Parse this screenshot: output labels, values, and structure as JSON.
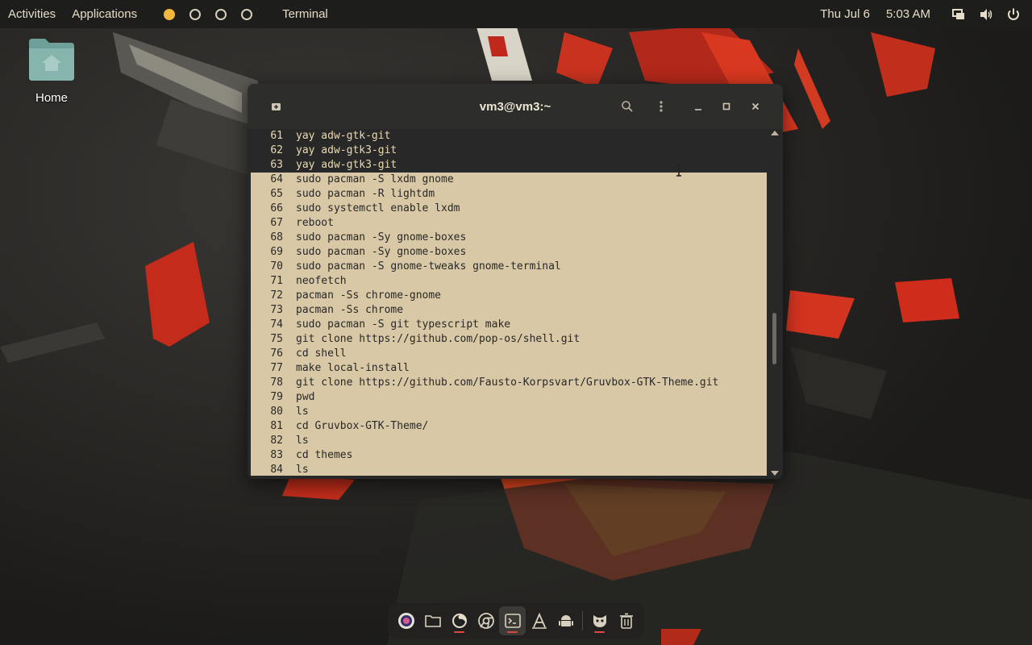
{
  "topbar": {
    "activities": "Activities",
    "applications": "Applications",
    "app_name": "Terminal",
    "date": "Thu Jul 6",
    "time": "5:03 AM",
    "workspaces": 4,
    "active_workspace": 1
  },
  "desktop": {
    "home_label": "Home"
  },
  "terminal": {
    "title": "vm3@vm3:~",
    "lines": [
      {
        "num": "61",
        "cmd": "yay adw-gtk-git",
        "selected": false
      },
      {
        "num": "62",
        "cmd": "yay adw-gtk3-git",
        "selected": false
      },
      {
        "num": "63",
        "cmd": "yay adw-gtk3-git",
        "selected": false
      },
      {
        "num": "64",
        "cmd": "sudo pacman -S lxdm gnome",
        "selected": true
      },
      {
        "num": "65",
        "cmd": "sudo pacman -R lightdm",
        "selected": true
      },
      {
        "num": "66",
        "cmd": "sudo systemctl enable lxdm",
        "selected": true
      },
      {
        "num": "67",
        "cmd": "reboot",
        "selected": true
      },
      {
        "num": "68",
        "cmd": "sudo pacman -Sy gnome-boxes",
        "selected": true
      },
      {
        "num": "69",
        "cmd": "sudo pacman -Sy gnome-boxes",
        "selected": true
      },
      {
        "num": "70",
        "cmd": "sudo pacman -S gnome-tweaks gnome-terminal",
        "selected": true
      },
      {
        "num": "71",
        "cmd": "neofetch",
        "selected": true
      },
      {
        "num": "72",
        "cmd": "pacman -Ss chrome-gnome",
        "selected": true
      },
      {
        "num": "73",
        "cmd": "pacman -Ss chrome",
        "selected": true
      },
      {
        "num": "74",
        "cmd": "sudo pacman -S git typescript make",
        "selected": true
      },
      {
        "num": "75",
        "cmd": "git clone https://github.com/pop-os/shell.git",
        "selected": true
      },
      {
        "num": "76",
        "cmd": "cd shell",
        "selected": true
      },
      {
        "num": "77",
        "cmd": "make local-install",
        "selected": true
      },
      {
        "num": "78",
        "cmd": "git clone https://github.com/Fausto-Korpsvart/Gruvbox-GTK-Theme.git",
        "selected": true
      },
      {
        "num": "79",
        "cmd": "pwd",
        "selected": true
      },
      {
        "num": "80",
        "cmd": "ls",
        "selected": true
      },
      {
        "num": "81",
        "cmd": "cd Gruvbox-GTK-Theme/",
        "selected": true
      },
      {
        "num": "82",
        "cmd": "ls",
        "selected": true
      },
      {
        "num": "83",
        "cmd": "cd themes",
        "selected": true
      },
      {
        "num": "84",
        "cmd": "ls",
        "selected": true
      }
    ]
  },
  "dock": {
    "items": [
      {
        "icon": "browser-icon",
        "running": false
      },
      {
        "icon": "files-icon",
        "running": false
      },
      {
        "icon": "firefox-icon",
        "running": true
      },
      {
        "icon": "chrome-icon",
        "running": false
      },
      {
        "icon": "terminal-icon",
        "running": true
      },
      {
        "icon": "text-editor-icon",
        "running": false
      },
      {
        "icon": "android-icon",
        "running": false
      },
      {
        "icon": "extensions-icon",
        "running": true
      },
      {
        "icon": "trash-icon",
        "running": false
      }
    ]
  },
  "colors": {
    "selection": "#d9c8a5",
    "terminal_bg": "#282828",
    "terminal_fg": "#ebdbb2",
    "accent": "#f2b53d",
    "wallpaper_red": "#d8311f"
  }
}
